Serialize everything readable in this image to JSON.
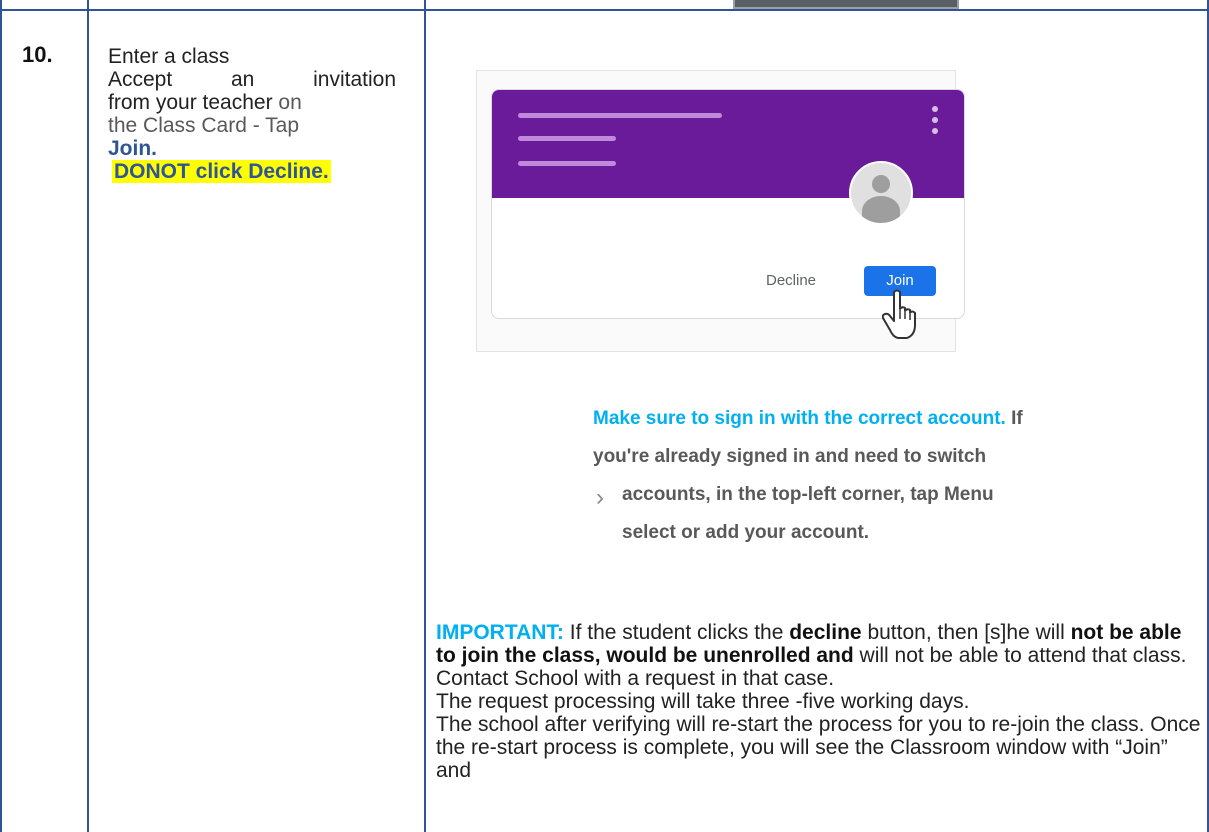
{
  "step": {
    "number": "10.",
    "title": "Enter a class",
    "line_accept": "Accept an invitation",
    "line_from": "from your teacher",
    "line_on": "on",
    "line_card": "the Class Card - Tap",
    "join_label": "Join.",
    "warning": "DONOT click Decline."
  },
  "card": {
    "decline_label": "Decline",
    "join_label": "Join"
  },
  "note": {
    "highlight": "Make sure to sign in with the correct account.",
    "if": "If",
    "line2": "you're already signed in and need to switch",
    "line3": "accounts, in the top-left corner, tap Menu",
    "line4": "select or add your account.",
    "chevron": "›"
  },
  "important": {
    "label": "IMPORTANT:",
    "t1": "If the student clicks the",
    "decline_word": "decline",
    "t2": "button, then [s]he will",
    "bold1": "not be able to join the class, would be unenrolled and",
    "t3": "will not be able to attend that class.",
    "line_contact": "Contact School with a request in that case.",
    "line_processing": "The request processing will take three -five working days.",
    "line_verify": "The school after verifying will re-start the process for you to re-join the class. Once the re-start process is complete, you will see the Classroom window with “Join” and"
  },
  "colors": {
    "table_border": "#2f5597",
    "banner": "#6a1b9a",
    "join_button": "#1a73e8",
    "accent_cyan": "#00b0f0",
    "highlight": "#ffff00"
  }
}
